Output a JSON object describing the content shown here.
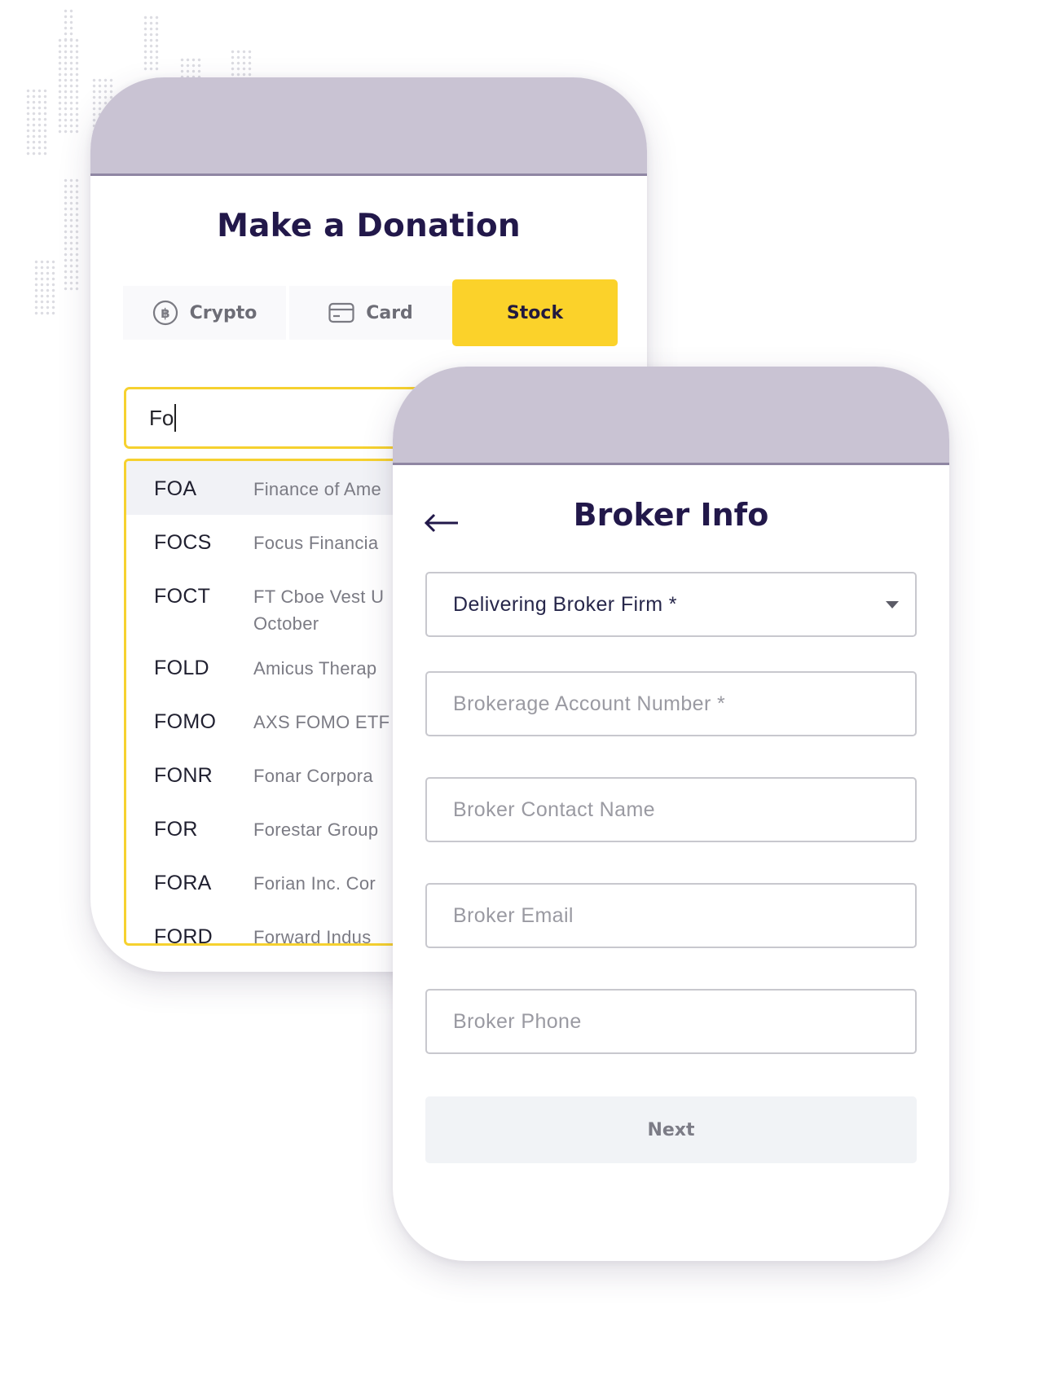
{
  "donation": {
    "title": "Make a Donation",
    "tabs": [
      {
        "label": "Crypto",
        "icon": "bitcoin-icon",
        "selected": false
      },
      {
        "label": "Card",
        "icon": "credit-card-icon",
        "selected": false
      },
      {
        "label": "Stock",
        "icon": null,
        "selected": true
      }
    ],
    "search_value": "Fo",
    "results": [
      {
        "symbol": "FOA",
        "name": "Finance of Ame",
        "highlighted": true
      },
      {
        "symbol": "FOCS",
        "name": "Focus Financia"
      },
      {
        "symbol": "FOCT",
        "name": "FT Cboe Vest U October"
      },
      {
        "symbol": "FOLD",
        "name": "Amicus Therap"
      },
      {
        "symbol": "FOMO",
        "name": "AXS FOMO ETF"
      },
      {
        "symbol": "FONR",
        "name": "Fonar Corpora"
      },
      {
        "symbol": "FOR",
        "name": "Forestar Group"
      },
      {
        "symbol": "FORA",
        "name": "Forian Inc. Cor"
      },
      {
        "symbol": "FORD",
        "name": "Forward Indus"
      }
    ]
  },
  "broker": {
    "title": "Broker Info",
    "back_icon": "arrow-left-icon",
    "firm_select": "Delivering Broker Firm *",
    "fields": [
      {
        "placeholder": "Brokerage Account Number *"
      },
      {
        "placeholder": "Broker Contact Name"
      },
      {
        "placeholder": "Broker Email"
      },
      {
        "placeholder": "Broker Phone"
      }
    ],
    "next_label": "Next"
  },
  "colors": {
    "accent_yellow": "#fbd22a",
    "header_lavender": "#c9c3d3",
    "title_navy": "#22184a"
  }
}
